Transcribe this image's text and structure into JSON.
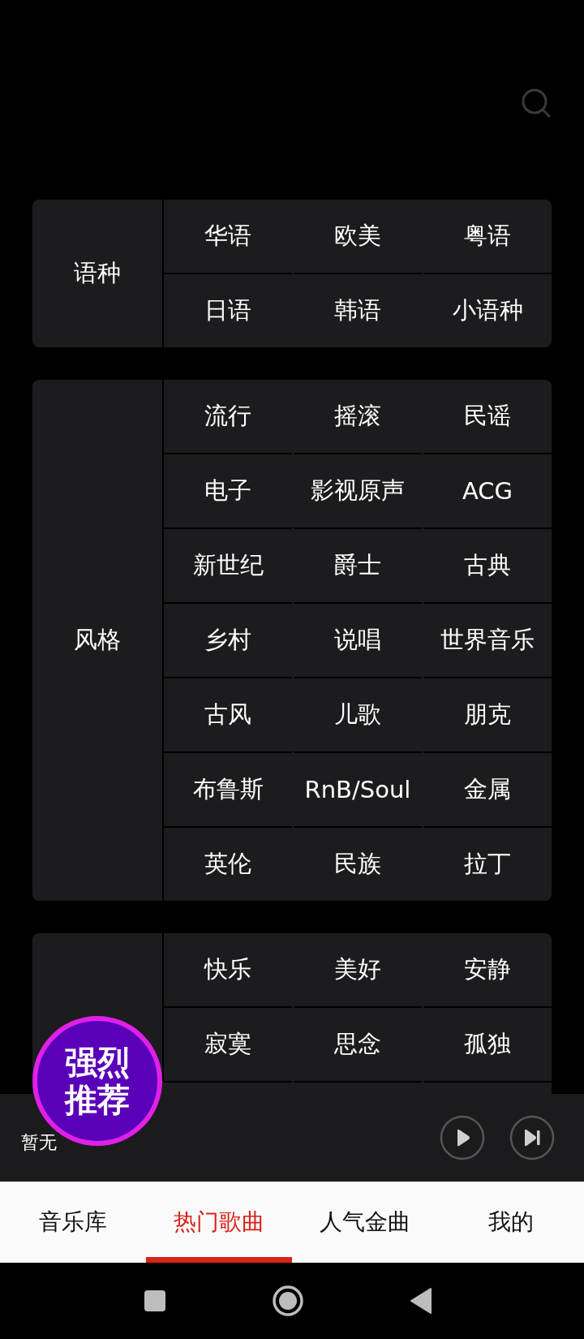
{
  "sections": [
    {
      "label": "语种",
      "tags": [
        "华语",
        "欧美",
        "粤语",
        "日语",
        "韩语",
        "小语种"
      ]
    },
    {
      "label": "风格",
      "tags": [
        "流行",
        "摇滚",
        "民谣",
        "电子",
        "影视原声",
        "ACG",
        "新世纪",
        "爵士",
        "古典",
        "乡村",
        "说唱",
        "世界音乐",
        "古风",
        "儿歌",
        "朋克",
        "布鲁斯",
        "RnB/Soul",
        "金属",
        "英伦",
        "民族",
        "拉丁"
      ]
    },
    {
      "tags": [
        "快乐",
        "美好",
        "安静",
        "寂寞",
        "思念",
        "孤独"
      ]
    }
  ],
  "badge": "强烈推荐",
  "player": {
    "status": "暂无"
  },
  "tabs": [
    {
      "label": "音乐库",
      "selected": false
    },
    {
      "label": "热门歌曲",
      "selected": true
    },
    {
      "label": "人气金曲",
      "selected": false
    },
    {
      "label": "我的",
      "selected": false
    }
  ]
}
